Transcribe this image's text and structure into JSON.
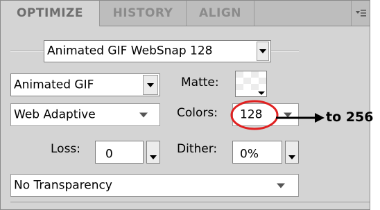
{
  "tabs": [
    {
      "label": "OPTIMIZE",
      "active": true
    },
    {
      "label": "HISTORY",
      "active": false
    },
    {
      "label": "ALIGN",
      "active": false
    }
  ],
  "preset": {
    "value": "Animated GIF WebSnap 128"
  },
  "format": {
    "value": "Animated GIF"
  },
  "matte": {
    "label": "Matte:"
  },
  "palette": {
    "value": "Web Adaptive"
  },
  "colors": {
    "label": "Colors:",
    "value": "128"
  },
  "loss": {
    "label": "Loss:",
    "value": "0"
  },
  "dither": {
    "label": "Dither:",
    "value": "0%"
  },
  "transparency": {
    "value": "No Transparency"
  },
  "annotation": {
    "text": "to 256",
    "circle_color": "#e02020",
    "arrow_color": "#000000"
  },
  "icons": [
    "panel-menu-icon",
    "dropdown-arrow-icon",
    "matte-swatch-icon"
  ]
}
